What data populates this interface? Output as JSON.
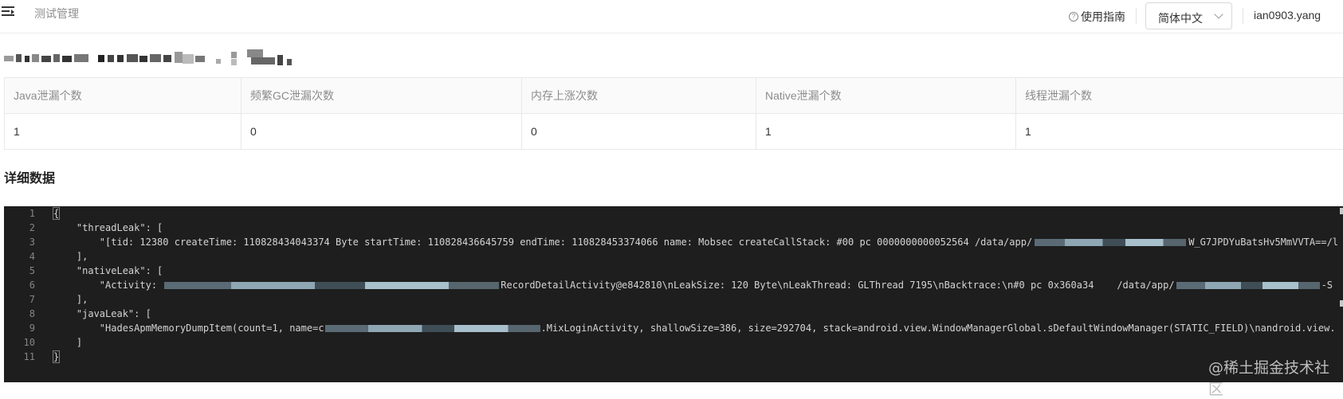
{
  "header": {
    "nav_title": "测试管理",
    "guide_label": "使用指南",
    "language_value": "简体中文",
    "username": "ian0903.yang"
  },
  "stats": {
    "columns": [
      "Java泄漏个数",
      "频繁GC泄漏次数",
      "内存上涨次数",
      "Native泄漏个数",
      "线程泄漏个数"
    ],
    "values": [
      "1",
      "0",
      "0",
      "1",
      "1"
    ]
  },
  "details": {
    "section_title": "详细数据",
    "line_numbers": [
      "1",
      "2",
      "3",
      "4",
      "5",
      "6",
      "7",
      "8",
      "9",
      "10",
      "11"
    ],
    "lines": [
      {
        "t": "{"
      },
      {
        "t": "    \"threadLeak\": ["
      },
      {
        "t": "        \"[tid: 12380 createTime: 110828434043374 Byte startTime: 110828436645759 endTime: 110828453374066 name: Mobsec createCallStack: #00 pc 0000000000052564 /data/app/",
        "tail": "W_G7JPDYuBatsHv5MmVVTA==/l"
      },
      {
        "t": "    ],"
      },
      {
        "t": "    \"nativeLeak\": ["
      },
      {
        "t": "        \"Activity: ",
        "tail": "RecordDetailActivity@e842810\\nLeakSize: 120 Byte\\nLeakThread: GLThread 7195\\nBacktrace:\\n#0 pc 0x360a34    /data/app/",
        "tail2": "-S"
      },
      {
        "t": "    ],"
      },
      {
        "t": "    \"javaLeak\": ["
      },
      {
        "t": "        \"HadesApmMemoryDumpItem(count=1, name=c",
        "tail": ".MixLoginActivity, shallowSize=386, size=292704, stack=android.view.WindowManagerGlobal.sDefaultWindowManager(STATIC_FIELD)\\nandroid.view."
      },
      {
        "t": "    ]"
      },
      {
        "t": "}"
      }
    ]
  },
  "watermark": "@稀土掘金技术社区",
  "colors": {
    "editor_bg": "#1e1e1e",
    "code_text": "#d4d4d4",
    "line_number": "#858585",
    "table_header_bg": "#fafafa",
    "border": "#e8e8e8"
  },
  "icons": {
    "menu": "menu-fold-icon",
    "guide": "question-circle-icon",
    "select": "chevron-down-icon"
  }
}
